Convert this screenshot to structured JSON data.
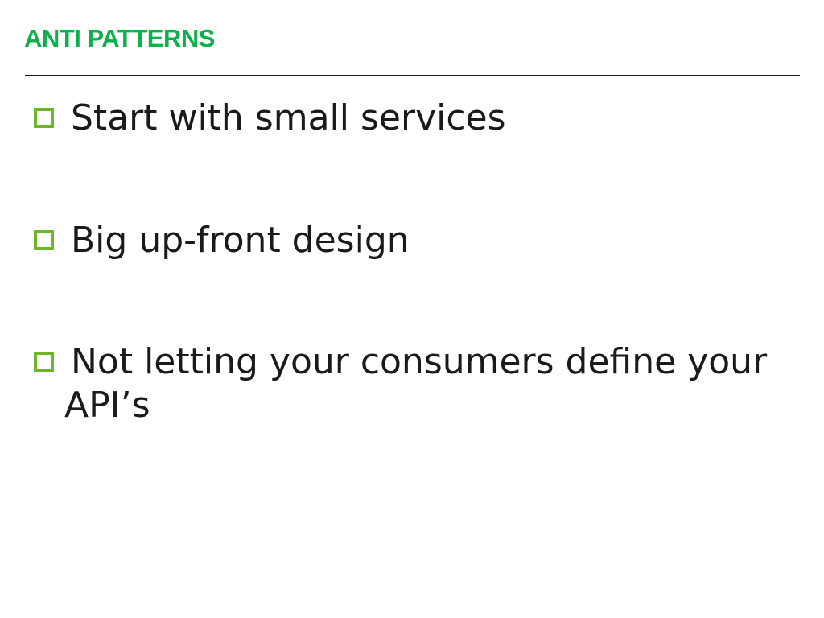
{
  "slide": {
    "title": "ANTI PATTERNS",
    "bullets": [
      {
        "text": "Start with small services",
        "icon": "checkbox-icon"
      },
      {
        "text": "Big up-front design",
        "icon": "checkbox-icon"
      },
      {
        "text": "Not letting your consumers define your API’s",
        "icon": "checkbox-icon"
      }
    ]
  },
  "colors": {
    "title": "#0db04b",
    "bullet_box": "#6fb52c",
    "text": "#1a1a1a",
    "rule": "#1a1a1a"
  }
}
